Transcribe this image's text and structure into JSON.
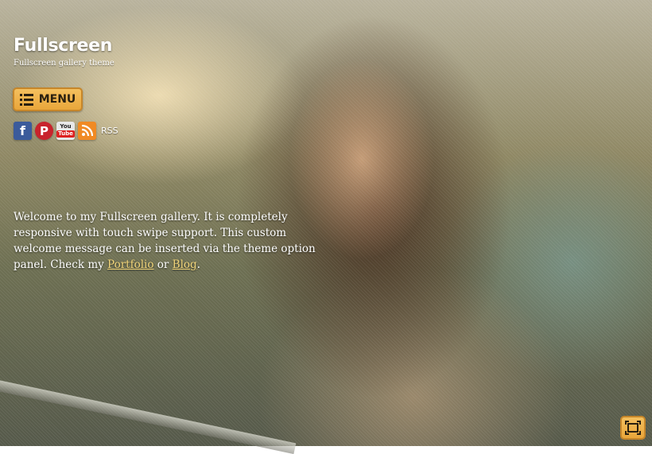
{
  "site": {
    "title": "Fullscreen",
    "tagline": "Fullscreen gallery theme"
  },
  "menu": {
    "label": "MENU",
    "icon": "list-icon"
  },
  "social": [
    {
      "name": "facebook",
      "icon": "facebook-icon",
      "glyph": "f"
    },
    {
      "name": "pinterest",
      "icon": "pinterest-icon",
      "glyph": "P"
    },
    {
      "name": "youtube",
      "icon": "youtube-icon",
      "glyph_top": "You",
      "glyph_bottom": "Tube"
    },
    {
      "name": "rss",
      "icon": "rss-icon"
    }
  ],
  "rss_label": "RSS",
  "welcome": {
    "text_before": "Welcome to my Fullscreen gallery. It is completely responsive with touch swipe support. This custom welcome message can be inserted via the theme option panel. Check my ",
    "link1": "Portfolio",
    "text_middle": " or ",
    "link2": "Blog",
    "text_after": "."
  },
  "fullscreen_button": {
    "icon": "fullscreen-icon"
  },
  "colors": {
    "accent": "#eeb04a",
    "accent_border": "#c6862a",
    "link": "#f2d57a"
  }
}
